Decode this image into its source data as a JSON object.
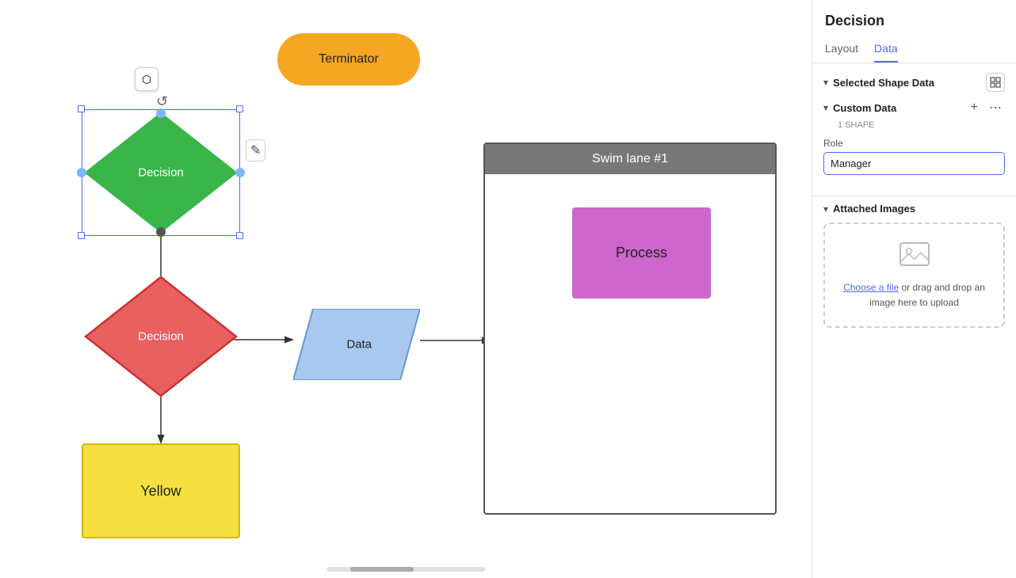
{
  "panel": {
    "title": "Decision",
    "tabs": [
      {
        "id": "layout",
        "label": "Layout"
      },
      {
        "id": "data",
        "label": "Data"
      }
    ],
    "active_tab": "data",
    "selected_shape_data": {
      "label": "Selected Shape Data"
    },
    "custom_data": {
      "label": "Custom Data",
      "subtitle": "1 SHAPE",
      "role_field": {
        "label": "Role",
        "value": "Manager"
      }
    },
    "attached_images": {
      "label": "Attached Images",
      "upload": {
        "link_text": "Choose a file",
        "text": " or drag and drop an image here to upload"
      }
    }
  },
  "canvas": {
    "shapes": {
      "terminator": {
        "label": "Terminator"
      },
      "decision1": {
        "label": "Decision"
      },
      "decision2": {
        "label": "Decision"
      },
      "data": {
        "label": "Data"
      },
      "swimlane": {
        "header": "Swim lane #1",
        "process": {
          "label": "Process"
        }
      },
      "yellow": {
        "label": "Yellow"
      }
    }
  },
  "icons": {
    "chevron_down": "▾",
    "plus": "+",
    "ellipsis": "⋯",
    "grid": "⊞",
    "rotate": "↺",
    "pen": "✎",
    "shapes_icon": "⬡△",
    "image_placeholder": "🖼"
  }
}
